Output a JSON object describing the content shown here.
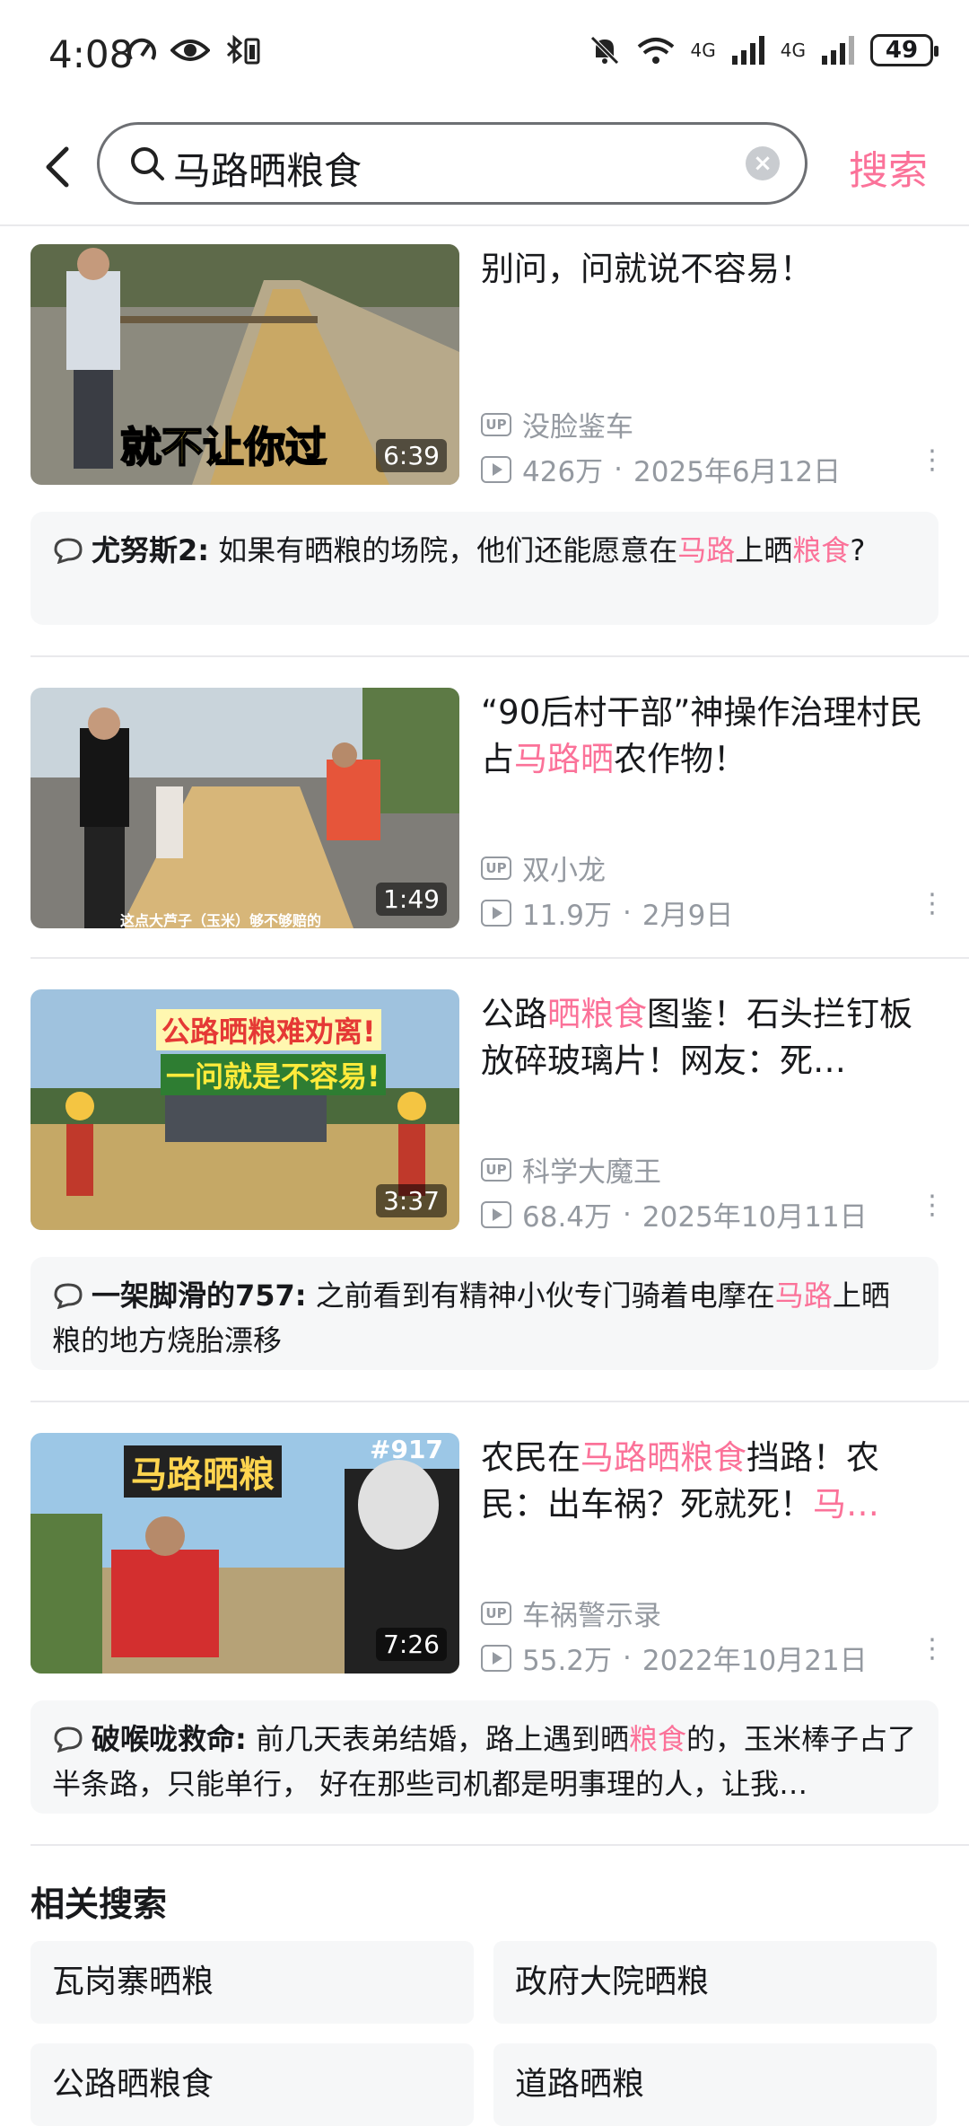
{
  "status": {
    "time": "4:08",
    "battery": "49",
    "network1": "6",
    "network2": "4G",
    "network3": "4G"
  },
  "search": {
    "query": "马路晒粮食",
    "submit_label": "搜索"
  },
  "results": [
    {
      "title_parts": [
        "别问，问就说不容易！",
        "",
        ""
      ],
      "author": "没脸鉴车",
      "views": "426万",
      "date": "2025年6月12日",
      "duration": "6:39",
      "overlay": "就不让你过",
      "comment": {
        "user": "尤努斯2:",
        "text_parts": [
          "如果有晒粮的场院，他们还能愿意在",
          "马路",
          "上晒",
          "粮食",
          "?"
        ]
      }
    },
    {
      "title_parts": [
        "“90后村干部”神操作治理村民占",
        "马路晒",
        "农作物！"
      ],
      "author": "双小龙",
      "views": "11.9万",
      "date": "2月9日",
      "duration": "1:49",
      "overlay": "这点大芦子（玉米）够不够赔的"
    },
    {
      "title_parts": [
        "公路",
        "晒粮食",
        "图鉴！石头拦钉板放碎玻璃片！网友：死…"
      ],
      "author": "科学大魔王",
      "views": "68.4万",
      "date": "2025年10月11日",
      "duration": "3:37",
      "overlay_top": "公路晒粮难劝离!",
      "overlay_bottom": "一问就是不容易!",
      "comment": {
        "user": "一架脚滑的757:",
        "text_parts": [
          "之前看到有精神小伙专门骑着电摩在",
          "马路",
          "上晒粮的地方烧胎漂移"
        ]
      }
    },
    {
      "title_parts": [
        "农民在",
        "马路晒粮食",
        "挡路！农民：出车祸？死就死！",
        "马…"
      ],
      "author": "车祸警示录",
      "views": "55.2万",
      "date": "2022年10月21日",
      "duration": "7:26",
      "overlay": "马路晒粮",
      "overlay_tag": "#917",
      "comment": {
        "user": "破喉咙救命:",
        "text_parts": [
          "前几天表弟结婚，路上遇到晒",
          "粮食",
          "的，玉米棒子占了半条路，只能单行，  好在那些司机都是明事理的人，让我…"
        ]
      }
    }
  ],
  "related": {
    "title": "相关搜索",
    "items": [
      "瓦岗寨晒粮",
      "政府大院晒粮",
      "公路晒粮食",
      "道路晒粮"
    ]
  },
  "colors": {
    "accent": "#fb7299",
    "meta": "#9499a0",
    "comment_bg": "#f6f7f8"
  }
}
